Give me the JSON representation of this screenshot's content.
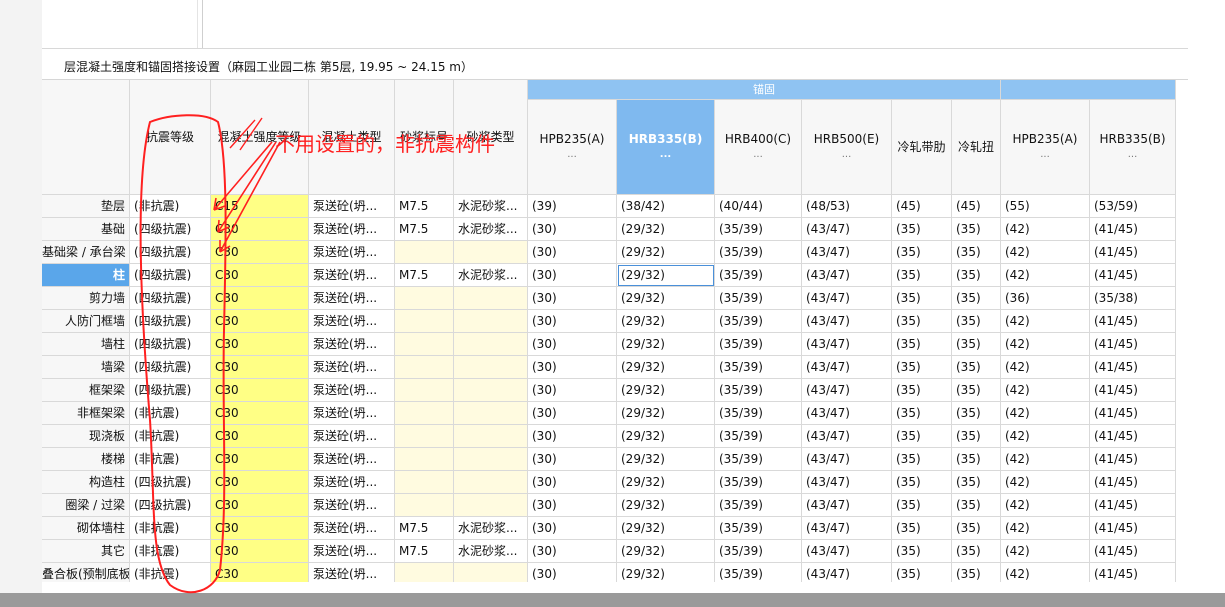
{
  "title": "层混凝土强度和锚固搭接设置（麻园工业园二栋  第5层, 19.95 ~ 24.15 m）",
  "group_header": "锚固",
  "columns": [
    {
      "label": "抗震等级",
      "dots": ""
    },
    {
      "label": "混凝土强度等级",
      "dots": ""
    },
    {
      "label": "混凝土类型",
      "dots": ""
    },
    {
      "label": "砂浆标号",
      "dots": ""
    },
    {
      "label": "砂浆类型",
      "dots": ""
    },
    {
      "label": "HPB235(A)",
      "dots": "..."
    },
    {
      "label": "HRB335(B)",
      "dots": "..."
    },
    {
      "label": "HRB400(C)",
      "dots": "..."
    },
    {
      "label": "HRB500(E)",
      "dots": "..."
    },
    {
      "label": "冷轧带肋",
      "dots": ""
    },
    {
      "label": "冷轧扭",
      "dots": ""
    },
    {
      "label": "HPB235(A)",
      "dots": "..."
    },
    {
      "label": "HRB335(B)",
      "dots": "..."
    }
  ],
  "rows": [
    {
      "name": "垫层",
      "cells": [
        "(非抗震)",
        "C15",
        "泵送砼(坍...",
        "M7.5",
        "水泥砂浆...",
        "(39)",
        "(38/42)",
        "(40/44)",
        "(48/53)",
        "(45)",
        "(45)",
        "(55)",
        "(53/59)"
      ]
    },
    {
      "name": "基础",
      "cells": [
        "(四级抗震)",
        "C30",
        "泵送砼(坍...",
        "M7.5",
        "水泥砂浆...",
        "(30)",
        "(29/32)",
        "(35/39)",
        "(43/47)",
        "(35)",
        "(35)",
        "(42)",
        "(41/45)"
      ]
    },
    {
      "name": "基础梁 / 承台梁",
      "cells": [
        "(四级抗震)",
        "C30",
        "泵送砼(坍...",
        "",
        "",
        "(30)",
        "(29/32)",
        "(35/39)",
        "(43/47)",
        "(35)",
        "(35)",
        "(42)",
        "(41/45)"
      ]
    },
    {
      "name": "柱",
      "cells": [
        "(四级抗震)",
        "C30",
        "泵送砼(坍...",
        "M7.5",
        "水泥砂浆...",
        "(30)",
        "(29/32)",
        "(35/39)",
        "(43/47)",
        "(35)",
        "(35)",
        "(42)",
        "(41/45)"
      ]
    },
    {
      "name": "剪力墙",
      "cells": [
        "(四级抗震)",
        "C30",
        "泵送砼(坍...",
        "",
        "",
        "(30)",
        "(29/32)",
        "(35/39)",
        "(43/47)",
        "(35)",
        "(35)",
        "(36)",
        "(35/38)"
      ]
    },
    {
      "name": "人防门框墙",
      "cells": [
        "(四级抗震)",
        "C30",
        "泵送砼(坍...",
        "",
        "",
        "(30)",
        "(29/32)",
        "(35/39)",
        "(43/47)",
        "(35)",
        "(35)",
        "(42)",
        "(41/45)"
      ]
    },
    {
      "name": "墙柱",
      "cells": [
        "(四级抗震)",
        "C30",
        "泵送砼(坍...",
        "",
        "",
        "(30)",
        "(29/32)",
        "(35/39)",
        "(43/47)",
        "(35)",
        "(35)",
        "(42)",
        "(41/45)"
      ]
    },
    {
      "name": "墙梁",
      "cells": [
        "(四级抗震)",
        "C30",
        "泵送砼(坍...",
        "",
        "",
        "(30)",
        "(29/32)",
        "(35/39)",
        "(43/47)",
        "(35)",
        "(35)",
        "(42)",
        "(41/45)"
      ]
    },
    {
      "name": "框架梁",
      "cells": [
        "(四级抗震)",
        "C30",
        "泵送砼(坍...",
        "",
        "",
        "(30)",
        "(29/32)",
        "(35/39)",
        "(43/47)",
        "(35)",
        "(35)",
        "(42)",
        "(41/45)"
      ]
    },
    {
      "name": "非框架梁",
      "cells": [
        "(非抗震)",
        "C30",
        "泵送砼(坍...",
        "",
        "",
        "(30)",
        "(29/32)",
        "(35/39)",
        "(43/47)",
        "(35)",
        "(35)",
        "(42)",
        "(41/45)"
      ]
    },
    {
      "name": "现浇板",
      "cells": [
        "(非抗震)",
        "C30",
        "泵送砼(坍...",
        "",
        "",
        "(30)",
        "(29/32)",
        "(35/39)",
        "(43/47)",
        "(35)",
        "(35)",
        "(42)",
        "(41/45)"
      ]
    },
    {
      "name": "楼梯",
      "cells": [
        "(非抗震)",
        "C30",
        "泵送砼(坍...",
        "",
        "",
        "(30)",
        "(29/32)",
        "(35/39)",
        "(43/47)",
        "(35)",
        "(35)",
        "(42)",
        "(41/45)"
      ]
    },
    {
      "name": "构造柱",
      "cells": [
        "(四级抗震)",
        "C30",
        "泵送砼(坍...",
        "",
        "",
        "(30)",
        "(29/32)",
        "(35/39)",
        "(43/47)",
        "(35)",
        "(35)",
        "(42)",
        "(41/45)"
      ]
    },
    {
      "name": "圈梁 / 过梁",
      "cells": [
        "(四级抗震)",
        "C30",
        "泵送砼(坍...",
        "",
        "",
        "(30)",
        "(29/32)",
        "(35/39)",
        "(43/47)",
        "(35)",
        "(35)",
        "(42)",
        "(41/45)"
      ]
    },
    {
      "name": "砌体墙柱",
      "cells": [
        "(非抗震)",
        "C30",
        "泵送砼(坍...",
        "M7.5",
        "水泥砂浆...",
        "(30)",
        "(29/32)",
        "(35/39)",
        "(43/47)",
        "(35)",
        "(35)",
        "(42)",
        "(41/45)"
      ]
    },
    {
      "name": "其它",
      "cells": [
        "(非抗震)",
        "C30",
        "泵送砼(坍...",
        "M7.5",
        "水泥砂浆...",
        "(30)",
        "(29/32)",
        "(35/39)",
        "(43/47)",
        "(35)",
        "(35)",
        "(42)",
        "(41/45)"
      ]
    },
    {
      "name": "叠合板(预制底板)",
      "cells": [
        "(非抗震)",
        "C30",
        "泵送砼(坍...",
        "",
        "",
        "(30)",
        "(29/32)",
        "(35/39)",
        "(43/47)",
        "(35)",
        "(35)",
        "(42)",
        "(41/45)"
      ]
    }
  ],
  "active_row": 3,
  "selected_column": 6,
  "annotation": {
    "text": "不用设置的，非抗震构件",
    "color": "#ff2020"
  },
  "colors": {
    "accent": "#5aa6ea",
    "group_header": "#8fc3f2",
    "concrete_yellow": "#ffff85",
    "mortar_light": "#fffbe0"
  }
}
